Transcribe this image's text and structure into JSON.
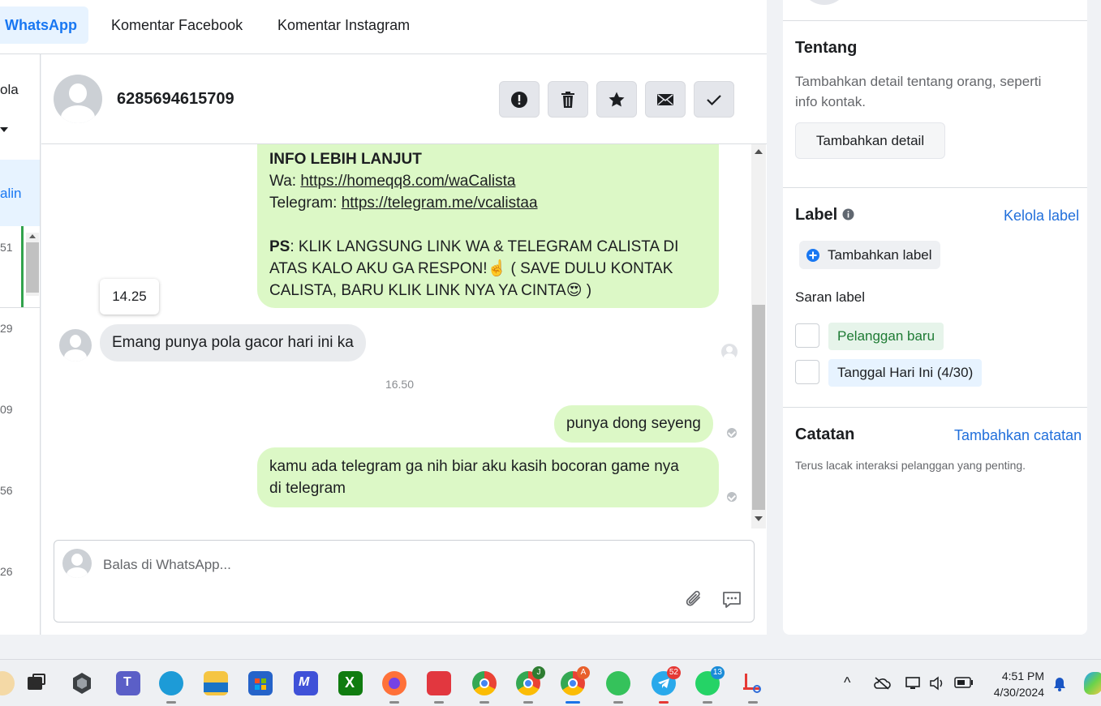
{
  "tabs": [
    {
      "label": "WhatsApp",
      "active": true
    },
    {
      "label": "Komentar Facebook",
      "active": false
    },
    {
      "label": "Komentar Instagram",
      "active": false
    }
  ],
  "left_list": {
    "fragments": [
      "ola",
      "alin"
    ],
    "times": [
      "51",
      "29",
      "09",
      "56",
      "26"
    ]
  },
  "chat": {
    "contact_name": "6285694615709",
    "header_buttons": [
      {
        "icon": "alert-icon",
        "name": "report-button"
      },
      {
        "icon": "trash-icon",
        "name": "delete-button"
      },
      {
        "icon": "star-icon",
        "name": "star-button"
      },
      {
        "icon": "mail-icon",
        "name": "mark-unread-button"
      },
      {
        "icon": "check-icon",
        "name": "done-button"
      }
    ],
    "promo": {
      "heading": "INFO LEBIH LANJUT",
      "wa_prefix": "Wa: ",
      "wa_link": "https://homeqq8.com/waCalista",
      "tg_prefix": "Telegram: ",
      "tg_link": "https://telegram.me/vcalistaa",
      "ps_label": "PS",
      "ps_line1": ": KLIK LANGSUNG LINK  WA & TELEGRAM CALISTA DI",
      "ps_line2": "ATAS KALO AKU GA RESPON!☝️ ( SAVE DULU KONTAK",
      "ps_line3": "CALISTA, BARU KLIK LINK NYA YA CINTA😍 )"
    },
    "tooltip_time": "14.25",
    "incoming": "Emang punya pola gacor hari ini ka",
    "day_time": "16.50",
    "reply1": "punya dong seyeng",
    "reply2_line1": "kamu ada telegram ga nih biar aku kasih bocoran game nya",
    "reply2_line2": "di telegram",
    "composer_placeholder": "Balas di WhatsApp..."
  },
  "right_panel": {
    "about_title": "Tentang",
    "about_desc_line1": "Tambahkan detail tentang orang, seperti",
    "about_desc_line2": "info kontak.",
    "add_detail_button": "Tambahkan detail",
    "label_title": "Label",
    "manage_labels": "Kelola label",
    "add_label_button": "Tambahkan label",
    "suggested_title": "Saran label",
    "suggested_labels": [
      {
        "label": "Pelanggan baru",
        "color": "#e6f4ea",
        "text_color": "#1e7b34"
      },
      {
        "label": "Tanggal Hari Ini (4/30)",
        "color": "#e7f3ff",
        "text_color": "#1c1e21"
      }
    ],
    "notes_title": "Catatan",
    "add_note": "Tambahkan catatan",
    "notes_desc": "Terus lacak interaksi pelanggan yang penting."
  },
  "taskbar": {
    "time": "4:51 PM",
    "date": "4/30/2024",
    "badges": {
      "telegram": "52",
      "whatsapp": "13",
      "chrome_j": "J",
      "chrome_a": "A"
    }
  },
  "colors": {
    "brand_blue": "#1877f2",
    "bubble_out": "#dcf8c6",
    "bubble_in": "#e9ebee"
  }
}
